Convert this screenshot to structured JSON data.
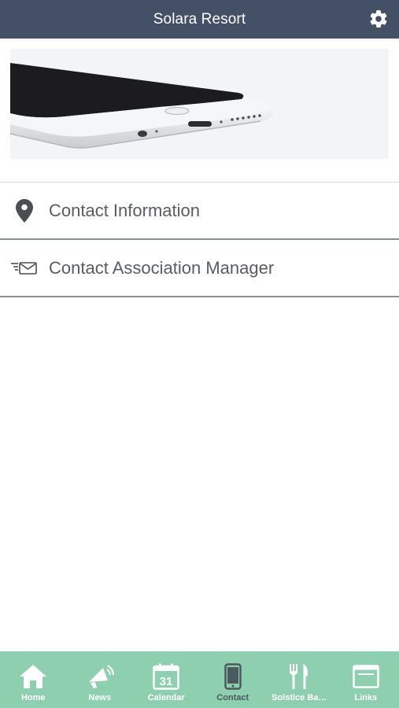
{
  "header": {
    "title": "Solara Resort",
    "settings_icon": "gear-icon"
  },
  "hero": {
    "image": "smartphone-photo"
  },
  "menu": {
    "items": [
      {
        "label": "Contact Information",
        "icon": "map-pin-icon"
      },
      {
        "label": "Contact Association Manager",
        "icon": "envelope-send-icon"
      }
    ]
  },
  "tabs": [
    {
      "label": "Home",
      "icon": "home-icon"
    },
    {
      "label": "News",
      "icon": "megaphone-icon"
    },
    {
      "label": "Calendar",
      "icon": "calendar-icon",
      "day": "31"
    },
    {
      "label": "Contact",
      "icon": "phone-icon",
      "active": true
    },
    {
      "label": "Solstice Ba…",
      "icon": "fork-knife-icon"
    },
    {
      "label": "Links",
      "icon": "browser-icon"
    }
  ],
  "colors": {
    "header_bg": "#445066",
    "tabbar_bg": "#8ecfb0",
    "active_tab_label": "#4b5a5e",
    "menu_text": "#595d63"
  }
}
